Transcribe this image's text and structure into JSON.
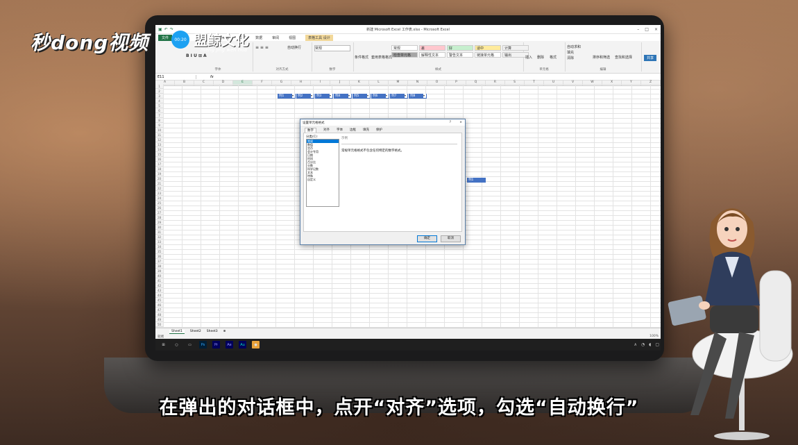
{
  "overlay": {
    "logo_text": "秒dong视频",
    "brand_name": "盟鲸文化",
    "brand_pinyin": "meng jing wen hua",
    "badge_time": "00:20",
    "subtitle": "在弹出的对话框中，点开“对齐”选项，勾选“自动换行”"
  },
  "excel": {
    "window_title": "新建 Microsoft Excel 工作表.xlsx - Microsoft Excel",
    "tabs": [
      "文件",
      "开始",
      "插入",
      "页面布局",
      "公式",
      "数据",
      "审阅",
      "视图",
      "设计"
    ],
    "context_tab": "表格工具",
    "ribbon": {
      "wrap_text": "自动换行",
      "number_format": "常规",
      "group_font": "字体",
      "group_alignment": "对齐方式",
      "group_number": "数字",
      "group_styles": "样式",
      "group_cells": "单元格",
      "group_editing": "编辑",
      "conditional_format": "条件格式",
      "table_format": "套用表格格式",
      "styles": [
        {
          "label": "常规",
          "bg": "#ffffff"
        },
        {
          "label": "差",
          "bg": "#ffc7ce"
        },
        {
          "label": "好",
          "bg": "#c6efce"
        },
        {
          "label": "适中",
          "bg": "#ffeb9c"
        },
        {
          "label": "计算",
          "bg": "#f2f2f2"
        },
        {
          "label": "检查单元格",
          "bg": "#a5a5a5"
        },
        {
          "label": "解释性文本",
          "bg": "#ffffff"
        },
        {
          "label": "警告文本",
          "bg": "#ffffff"
        },
        {
          "label": "链接单元格",
          "bg": "#ffffff"
        },
        {
          "label": "输出",
          "bg": "#f2f2f2"
        }
      ],
      "insert": "插入",
      "delete": "删除",
      "format": "格式",
      "autosum": "自动求和",
      "fill": "填充",
      "clear": "清除",
      "sort_filter": "排序和筛选",
      "find_select": "查找和选择",
      "share": "共享"
    },
    "name_box": "E11",
    "columns": [
      "A",
      "B",
      "C",
      "D",
      "E",
      "F",
      "G",
      "H",
      "I",
      "J",
      "K",
      "L",
      "M",
      "N",
      "O",
      "P",
      "Q",
      "R",
      "S",
      "T",
      "U",
      "V",
      "W",
      "X",
      "Y",
      "Z"
    ],
    "selected_column": "E",
    "table_headers": [
      "列1",
      "列2",
      "列3",
      "列4",
      "列5",
      "列6",
      "列7",
      "列8"
    ],
    "single_header": "列1",
    "sheet_tabs": [
      "Sheet1",
      "Sheet2",
      "Sheet3"
    ],
    "status": "就绪",
    "zoom": "100%"
  },
  "dialog": {
    "title": "设置单元格格式",
    "help": "?",
    "close": "×",
    "tabs": [
      "数字",
      "对齐",
      "字体",
      "边框",
      "填充",
      "保护"
    ],
    "active_tab": "数字",
    "category_label": "分类(C):",
    "categories": [
      "常规",
      "数值",
      "货币",
      "会计专用",
      "日期",
      "时间",
      "百分比",
      "分数",
      "科学记数",
      "文本",
      "特殊",
      "自定义"
    ],
    "selected_category": "常规",
    "sample_label": "示例",
    "description": "常规单元格格式不包含任何特定的数字格式。",
    "ok": "确定",
    "cancel": "取消"
  },
  "taskbar": {
    "icons": [
      "Ps",
      "Pr",
      "Ae",
      "Au"
    ],
    "ps_color": "#31a8ff",
    "pr_color": "#9999ff",
    "ae_color": "#9999ff",
    "au_color": "#00e4bb"
  }
}
